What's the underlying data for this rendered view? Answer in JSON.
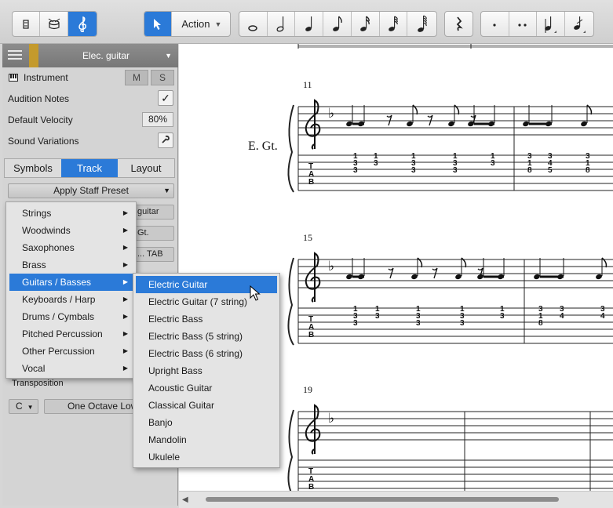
{
  "toolbar": {
    "mode_icons": [
      "mixer-icon",
      "drum-icon",
      "treble-clef-icon"
    ],
    "action_label": "Action",
    "note_icons": [
      "whole-note-icon",
      "half-note-icon",
      "quarter-note-icon",
      "eighth-note-icon",
      "sixteenth-note-icon",
      "thirty-second-note-icon",
      "sixty-fourth-note-icon"
    ],
    "rest_icon": "rest-icon",
    "modifier_icons": [
      "dot-icon",
      "double-dot-icon",
      "tuplet-icon",
      "grace-note-icon"
    ]
  },
  "track": {
    "name": "Elec. guitar",
    "color": "#c49a2c",
    "instrument_label": "Instrument",
    "mute_label": "M",
    "solo_label": "S",
    "audition_label": "Audition Notes",
    "audition_checked": "✓",
    "velocity_label": "Default Velocity",
    "velocity_value": "80%",
    "sound_variations_label": "Sound Variations"
  },
  "tabs": [
    {
      "label": "Symbols",
      "active": false
    },
    {
      "label": "Track",
      "active": true
    },
    {
      "label": "Layout",
      "active": false
    }
  ],
  "apply_preset_label": "Apply Staff Preset",
  "hidden_fields": {
    "guitar_fragment": "guitar",
    "gt_fragment": "Gt.",
    "tab_fragment": "... TAB"
  },
  "transposition": {
    "label": "Transposition",
    "key": "C",
    "octave": "One Octave Lower"
  },
  "category_menu": {
    "items": [
      {
        "label": "Strings",
        "highlighted": false
      },
      {
        "label": "Woodwinds",
        "highlighted": false
      },
      {
        "label": "Saxophones",
        "highlighted": false
      },
      {
        "label": "Brass",
        "highlighted": false
      },
      {
        "label": "Guitars / Basses",
        "highlighted": true
      },
      {
        "label": "Keyboards / Harp",
        "highlighted": false
      },
      {
        "label": "Drums / Cymbals",
        "highlighted": false
      },
      {
        "label": "Pitched Percussion",
        "highlighted": false
      },
      {
        "label": "Other Percussion",
        "highlighted": false
      },
      {
        "label": "Vocal",
        "highlighted": false
      }
    ]
  },
  "instrument_menu": {
    "items": [
      {
        "label": "Electric Guitar",
        "highlighted": true
      },
      {
        "label": "Electric Guitar (7 string)",
        "highlighted": false
      },
      {
        "label": "Electric Bass",
        "highlighted": false
      },
      {
        "label": "Electric Bass (5 string)",
        "highlighted": false
      },
      {
        "label": "Electric Bass (6 string)",
        "highlighted": false
      },
      {
        "label": "Upright Bass",
        "highlighted": false
      },
      {
        "label": "Acoustic Guitar",
        "highlighted": false
      },
      {
        "label": "Classical Guitar",
        "highlighted": false
      },
      {
        "label": "Banjo",
        "highlighted": false
      },
      {
        "label": "Mandolin",
        "highlighted": false
      },
      {
        "label": "Ukulele",
        "highlighted": false
      }
    ]
  },
  "score": {
    "track_label": "E. Gt.",
    "tab_label_top": "T",
    "tab_label_mid": "A",
    "tab_label_bot": "B",
    "systems": [
      {
        "measure_number": "11",
        "tab_columns": [
          [
            "1",
            "3",
            "3"
          ],
          [
            "1",
            "3"
          ],
          [
            "1",
            "3",
            "3"
          ],
          [
            "1",
            "3",
            "3"
          ],
          [
            "1",
            "3"
          ],
          [
            "3",
            "1",
            "8"
          ],
          [
            "3",
            "4",
            "5"
          ],
          [
            "3",
            "1",
            "8"
          ]
        ]
      },
      {
        "measure_number": "15",
        "tab_columns": [
          [
            "1",
            "3",
            "3"
          ],
          [
            "1",
            "3"
          ],
          [
            "1",
            "3",
            "3"
          ],
          [
            "1",
            "3",
            "3"
          ],
          [
            "1",
            "3"
          ],
          [
            "3",
            "1",
            "8"
          ],
          [
            "3",
            "4"
          ],
          [
            "3",
            "4"
          ]
        ]
      },
      {
        "measure_number": "19",
        "tab_columns": []
      }
    ]
  }
}
